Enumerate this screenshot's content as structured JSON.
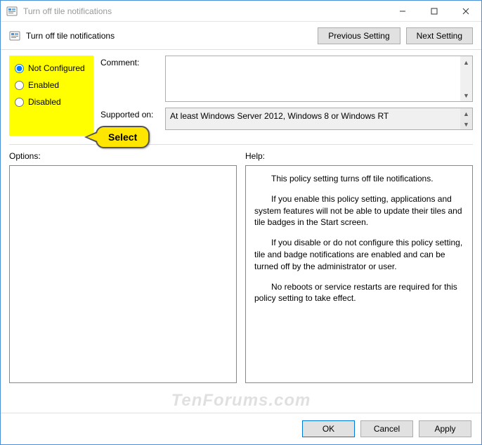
{
  "window": {
    "title": "Turn off tile notifications"
  },
  "toolbar": {
    "policy_name": "Turn off tile notifications",
    "prev_setting": "Previous Setting",
    "next_setting": "Next Setting"
  },
  "state": {
    "not_configured": "Not Configured",
    "enabled": "Enabled",
    "disabled": "Disabled",
    "selected": "not_configured"
  },
  "callout": {
    "text": "Select"
  },
  "fields": {
    "comment_label": "Comment:",
    "comment_value": "",
    "supported_label": "Supported on:",
    "supported_value": "At least Windows Server 2012, Windows 8 or Windows RT"
  },
  "panels": {
    "options_label": "Options:",
    "help_label": "Help:",
    "help_paragraphs": [
      "This policy setting turns off tile notifications.",
      "If you enable this policy setting, applications and system features will not be able to update their tiles and tile badges in the Start screen.",
      "If you disable or do not configure this policy setting, tile and badge notifications are enabled and can be turned off by the administrator or user.",
      "No reboots or service restarts are required for this policy setting to take effect."
    ]
  },
  "footer": {
    "ok": "OK",
    "cancel": "Cancel",
    "apply": "Apply"
  },
  "watermark": "TenForums.com"
}
